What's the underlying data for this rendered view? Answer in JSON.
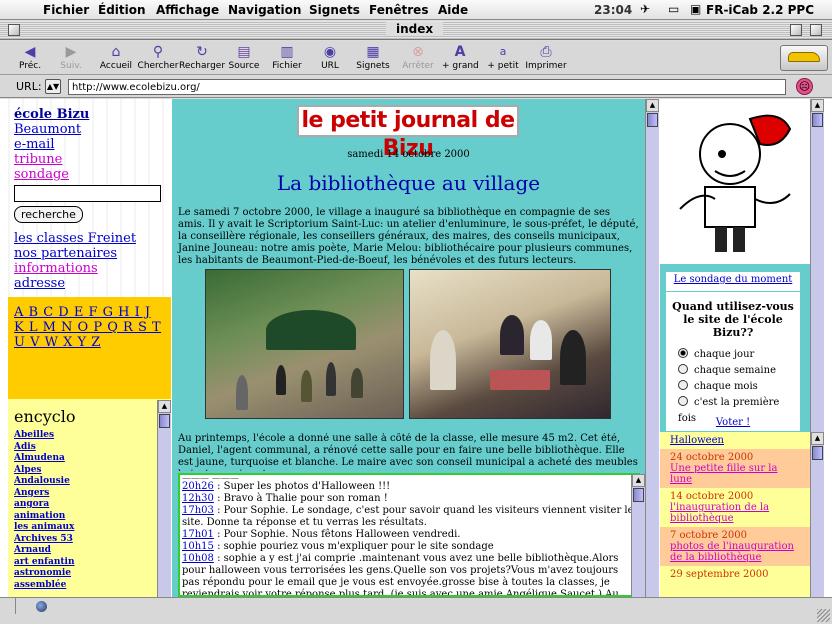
{
  "menubar": {
    "items": [
      "Fichier",
      "Édition",
      "Affichage",
      "Navigation",
      "Signets",
      "Fenêtres",
      "Aide"
    ],
    "clock": "23:04",
    "app_name": "FR-iCab 2.2 PPC"
  },
  "window": {
    "title": "index"
  },
  "toolbar": {
    "buttons": [
      {
        "label": "Préc.",
        "icon": "back-arrow-icon"
      },
      {
        "label": "Suiv.",
        "icon": "forward-arrow-icon"
      },
      {
        "label": "Accueil",
        "icon": "home-icon"
      },
      {
        "label": "Chercher",
        "icon": "magnifier-icon"
      },
      {
        "label": "Recharger",
        "icon": "reload-icon"
      },
      {
        "label": "Source",
        "icon": "source-icon"
      },
      {
        "label": "Fichier",
        "icon": "file-icon"
      },
      {
        "label": "URL",
        "icon": "url-globe-icon"
      },
      {
        "label": "Signets",
        "icon": "bookmark-icon"
      },
      {
        "label": "Arrêter",
        "icon": "stop-icon"
      },
      {
        "label": "+ grand",
        "icon": "bigger-text-icon"
      },
      {
        "label": "+ petit",
        "icon": "smaller-text-icon"
      },
      {
        "label": "Imprimer",
        "icon": "printer-icon"
      }
    ]
  },
  "urlbar": {
    "label": "URL:",
    "value": "http://www.ecolebizu.org/"
  },
  "left": {
    "nav": [
      {
        "label": "école Bizu"
      },
      {
        "label": "Beaumont"
      },
      {
        "label": "e-mail"
      },
      {
        "label": "tribune"
      },
      {
        "label": "sondage"
      }
    ],
    "search_button": "recherche",
    "nav2": [
      {
        "label": "les classes Freinet"
      },
      {
        "label": "nos partenaires"
      },
      {
        "label": "informations"
      },
      {
        "label": "adresse"
      }
    ],
    "alphabet_rows": [
      "A B C D E F G H I J",
      "K L M N O P Q R S T",
      "U V W X Y Z"
    ],
    "encyclo_title": "encyclo",
    "encyclo_items": [
      "Abeilles",
      "Adis",
      "Almudena",
      "Alpes",
      "Andalousie",
      "Angers",
      "angora",
      "animation",
      "les animaux",
      "Archives 53",
      "Arnaud",
      "art enfantin",
      "astronomie",
      "assemblée"
    ]
  },
  "main": {
    "logo": "le petit journal de Bizu",
    "date": "samedi 14 octobre 2000",
    "headline": "La bibliothèque au village",
    "intro": "Le samedi 7 octobre 2000, le village a inauguré sa bibliothèque en compagnie de ses amis. Il y avait le Scriptorium Saint-Luc: un atelier d'enluminure, le sous-préfet, le député, la conseillère régionale, les conseillers généraux, des maires, des conseils municipaux, Janine Jouneau: notre amis poète, Marie Melou: bibliothécaire pour plusieurs communes, les habitants de Beaumont-Pied-de-Boeuf, les bénévoles et des futurs lecteurs.",
    "body": "Au printemps, l'école a donné une salle à côté de la classe, elle mesure 45  m2. Cet été, Daniel, l'agent communal, a rénové cette salle pour en faire une belle bibliothèque. Elle est jaune, turquoise et blanche. Le maire avec son conseil municipal a acheté des meubles bois, turquoise et",
    "guestbook": [
      {
        "time": "20h26",
        "text": " : Super les photos d'Halloween !!!"
      },
      {
        "time": "12h30",
        "text": " : Bravo à Thalie pour son roman !"
      },
      {
        "time": "17h03",
        "text": " : Pour Sophie. Le sondage, c'est pour savoir quand les visiteurs viennent visiter le site. Donne ta réponse et tu verras les résultats."
      },
      {
        "time": "17h01",
        "text": " : Pour Sophie. Nous fêtons Halloween vendredi."
      },
      {
        "time": "10h15",
        "text": " : sophie pouriez vous m'expliquer pour le site sondage"
      },
      {
        "time": "10h08",
        "text": " : sophie a y est j'ai comprie .maintenant vous avez une belle bibliothèque.Alors pour halloween vous terrorisées les gens.Quelle son vos projets?Vous m'avez toujours pas répondu pour le email que je vous est envoyée.grosse bise à toutes la classes, je reviendrais voir votre réponse plus tard. (je suis avec une amie Angélique Saucet.) Au revoir. Sophie"
      }
    ]
  },
  "right": {
    "poll_title": "Le sondage du moment",
    "poll_question": "Quand utilisez-vous le site de l'école Bizu??",
    "poll_options": [
      "chaque jour",
      "chaque semaine",
      "chaque mois",
      "c'est la première fois"
    ],
    "poll_selected": "chaque jour",
    "vote_label": "Voter !",
    "news": [
      {
        "date": "",
        "title": "Halloween"
      },
      {
        "date": "24 octobre 2000",
        "title": "Une petite fille sur la lune"
      },
      {
        "date": "14 octobre 2000",
        "title": "l'inauguration de la bibliothèque"
      },
      {
        "date": "7 octobre 2000",
        "title": "photos de l'inauguration de la bibliothèque"
      },
      {
        "date": "29 septembre 2000",
        "title": ""
      }
    ]
  }
}
